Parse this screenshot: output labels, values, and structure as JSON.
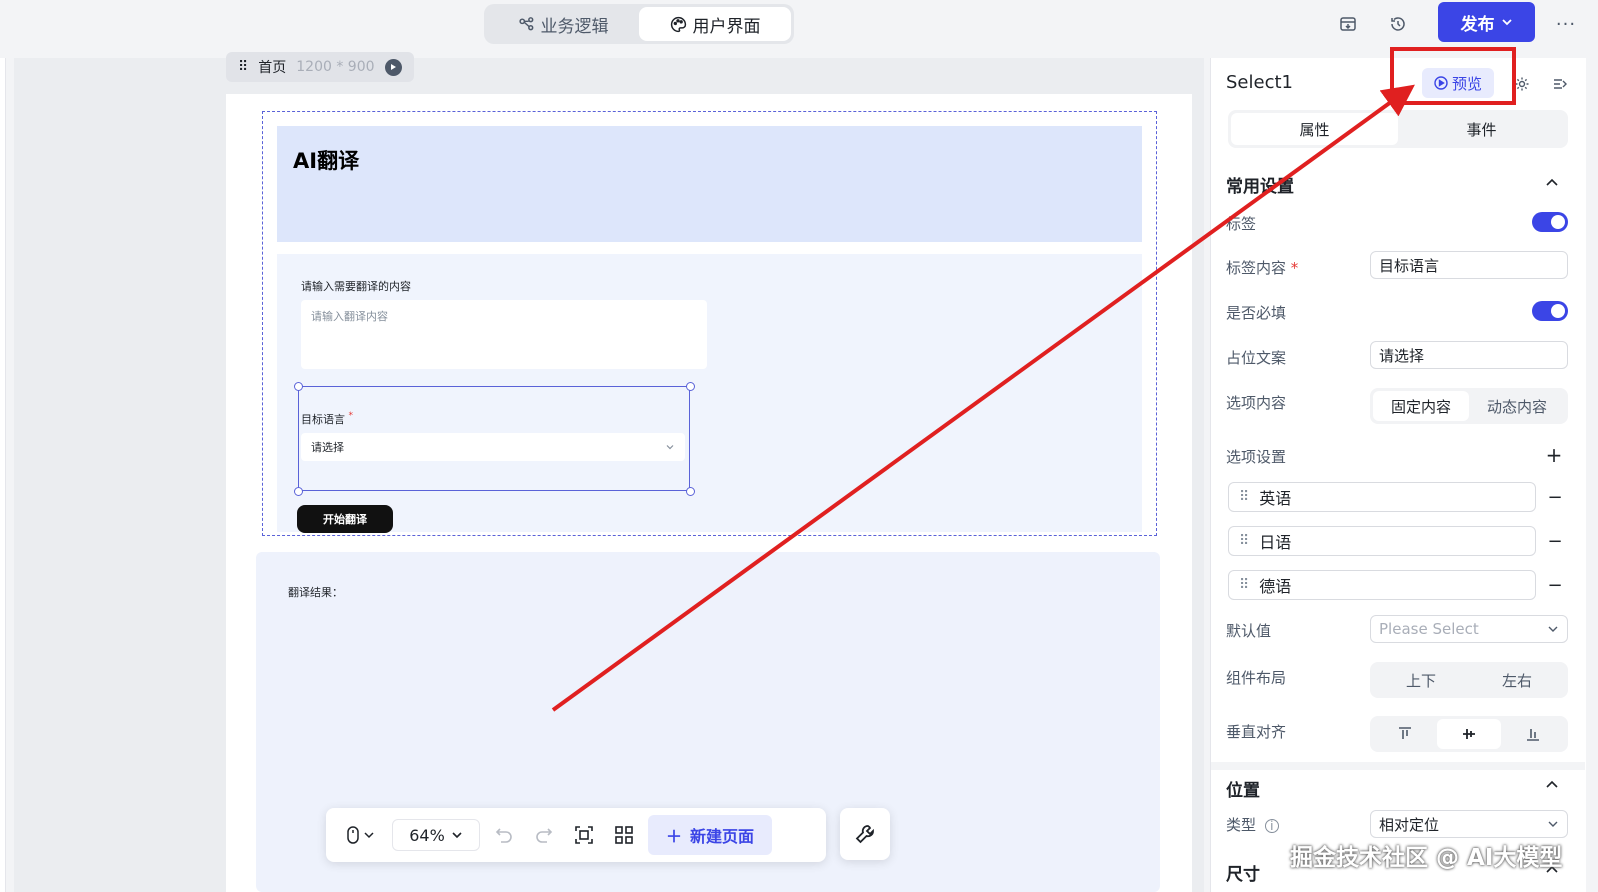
{
  "topbar": {
    "tabs": [
      {
        "label": "业务逻辑",
        "icon": "logic-icon"
      },
      {
        "label": "用户界面",
        "icon": "palette-icon"
      }
    ],
    "publish_label": "发布",
    "more_label": "···"
  },
  "canvas": {
    "page_name": "首页",
    "page_size": "1200 * 900",
    "hero_title": "AI翻译",
    "input_label": "请输入需要翻译的内容",
    "input_placeholder": "请输入翻译内容",
    "select_label": "目标语言",
    "select_required_mark": "*",
    "select_value": "请选择",
    "start_button": "开始翻译",
    "result_label": "翻译结果："
  },
  "toolbar": {
    "zoom": "64%",
    "new_page": "新建页面"
  },
  "panel": {
    "component_name": "Select1",
    "preview_label": "预览",
    "tabs": [
      "属性",
      "事件"
    ],
    "common_section": "常用设置",
    "label_toggle": "标签",
    "label_content": "标签内容",
    "required_mark": "*",
    "label_content_value": "目标语言",
    "required_label": "是否必填",
    "placeholder_label": "占位文案",
    "placeholder_value": "请选择",
    "options_content_label": "选项内容",
    "options_content_modes": [
      "固定内容",
      "动态内容"
    ],
    "options_settings_label": "选项设置",
    "options": [
      "英语",
      "日语",
      "德语"
    ],
    "default_label": "默认值",
    "default_placeholder": "Please Select",
    "layout_label": "组件布局",
    "layout_modes": [
      "上下",
      "左右"
    ],
    "valign_label": "垂直对齐",
    "position_section": "位置",
    "type_label": "类型",
    "type_value": "相对定位",
    "size_section": "尺寸"
  },
  "colors": {
    "accent": "#3b45e6",
    "annotation": "#e02020",
    "hero_bg": "#dde6fb"
  },
  "watermark": "掘金技术社区 @ AI大模型"
}
